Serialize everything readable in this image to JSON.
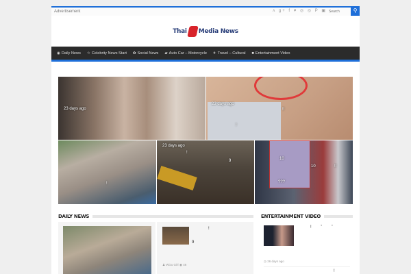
{
  "topbar": {
    "advertisement": "Advertisement",
    "social_icons": [
      "rss-icon",
      "google-plus-icon",
      "facebook-icon",
      "twitter-icon",
      "dribbble-icon",
      "pinterest-icon",
      "foursquare-icon",
      "instagram-icon"
    ],
    "social_glyphs": "ᴧ g+ f ♥ ◎ ◎ P ▣",
    "search_placeholder": "Search"
  },
  "logo": {
    "left": "Thai",
    "right": "Media News"
  },
  "nav": [
    {
      "icon": "globe-icon",
      "glyph": "◉",
      "label": "Daily News"
    },
    {
      "icon": "star-icon",
      "glyph": "☆",
      "label": "Celebrity News Start"
    },
    {
      "icon": "gear-icon",
      "glyph": "✿",
      "label": "Social News"
    },
    {
      "icon": "car-icon",
      "glyph": "▰",
      "label": "Auto Car – Motorcycle"
    },
    {
      "icon": "plane-icon",
      "glyph": "✈",
      "label": "Travel – Cultural"
    },
    {
      "icon": "video-icon",
      "glyph": "■",
      "label": "Entertainment Video"
    }
  ],
  "featured": [
    {
      "date": "23 days ago"
    },
    {
      "date": "23 days ago",
      "mark": "!",
      "mark2": "!!"
    },
    {
      "mark": "!"
    },
    {
      "date": "23 days ago",
      "mark": "!",
      "num": "9"
    },
    {
      "num": "10",
      "num2": "10",
      "mark": "!!",
      "q": "???"
    }
  ],
  "daily": {
    "title": "DAILY NEWS",
    "item": {
      "mark": "!",
      "num": "9",
      "author": "Wizu Girl",
      "views": "46"
    }
  },
  "video": {
    "title": "ENTERTAINMENT VIDEO",
    "item": {
      "marks": "! ˚ ˚",
      "date": "26 days ago"
    },
    "next_mark": "!"
  },
  "colors": {
    "accent": "#1e6fd9",
    "nav": "#2b2b2b",
    "logo_red": "#d8232a"
  }
}
